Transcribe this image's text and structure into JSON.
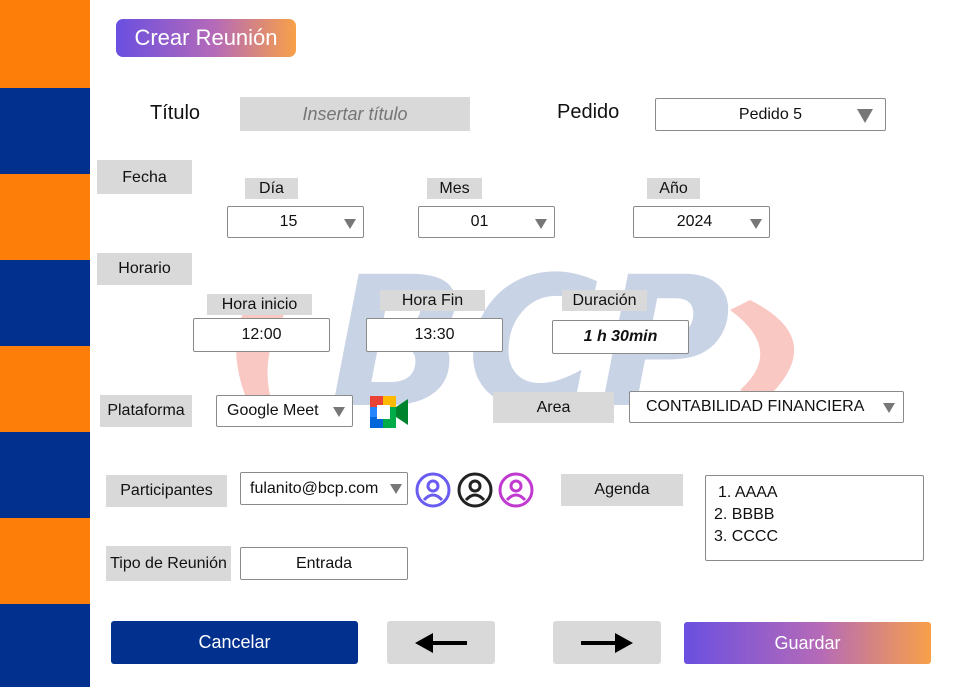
{
  "header": {
    "title": "Crear Reunión"
  },
  "form": {
    "titulo": {
      "label": "Título",
      "placeholder": "Insertar título"
    },
    "pedido": {
      "label": "Pedido",
      "value": "Pedido 5"
    },
    "fecha": {
      "label": "Fecha",
      "dia": {
        "label": "Día",
        "value": "15"
      },
      "mes": {
        "label": "Mes",
        "value": "01"
      },
      "anio": {
        "label": "Año",
        "value": "2024"
      }
    },
    "horario": {
      "label": "Horario",
      "inicio": {
        "label": "Hora inicio",
        "value": "12:00"
      },
      "fin": {
        "label": "Hora Fin",
        "value": "13:30"
      },
      "duracion": {
        "label": "Duración",
        "value": "1 h 30min"
      }
    },
    "plataforma": {
      "label": "Plataforma",
      "value": "Google Meet",
      "icon": "google-meet-icon"
    },
    "area": {
      "label": "Area",
      "value": "CONTABILIDAD FINANCIERA"
    },
    "participantes": {
      "label": "Participantes",
      "value": "fulanito@bcp.com",
      "avatars": [
        {
          "icon": "user-icon",
          "color": "#6a5cf0"
        },
        {
          "icon": "user-icon",
          "color": "#222222"
        },
        {
          "icon": "user-icon",
          "color": "#c03ad0"
        }
      ]
    },
    "agenda": {
      "label": "Agenda",
      "items": [
        "1. AAAA",
        "2. BBBB",
        "3. CCCC"
      ]
    },
    "tipo": {
      "label": "Tipo de Reunión",
      "value": "Entrada"
    }
  },
  "actions": {
    "cancel": "Cancelar",
    "save": "Guardar",
    "back_icon": "arrow-left-icon",
    "forward_icon": "arrow-right-icon"
  },
  "watermark": {
    "text": "BCP"
  },
  "colors": {
    "orange": "#fd7f0a",
    "navy": "#01308f",
    "gray": "#d9d9d9",
    "gradient_start": "#6a4fe0",
    "gradient_end": "#f8a048"
  }
}
